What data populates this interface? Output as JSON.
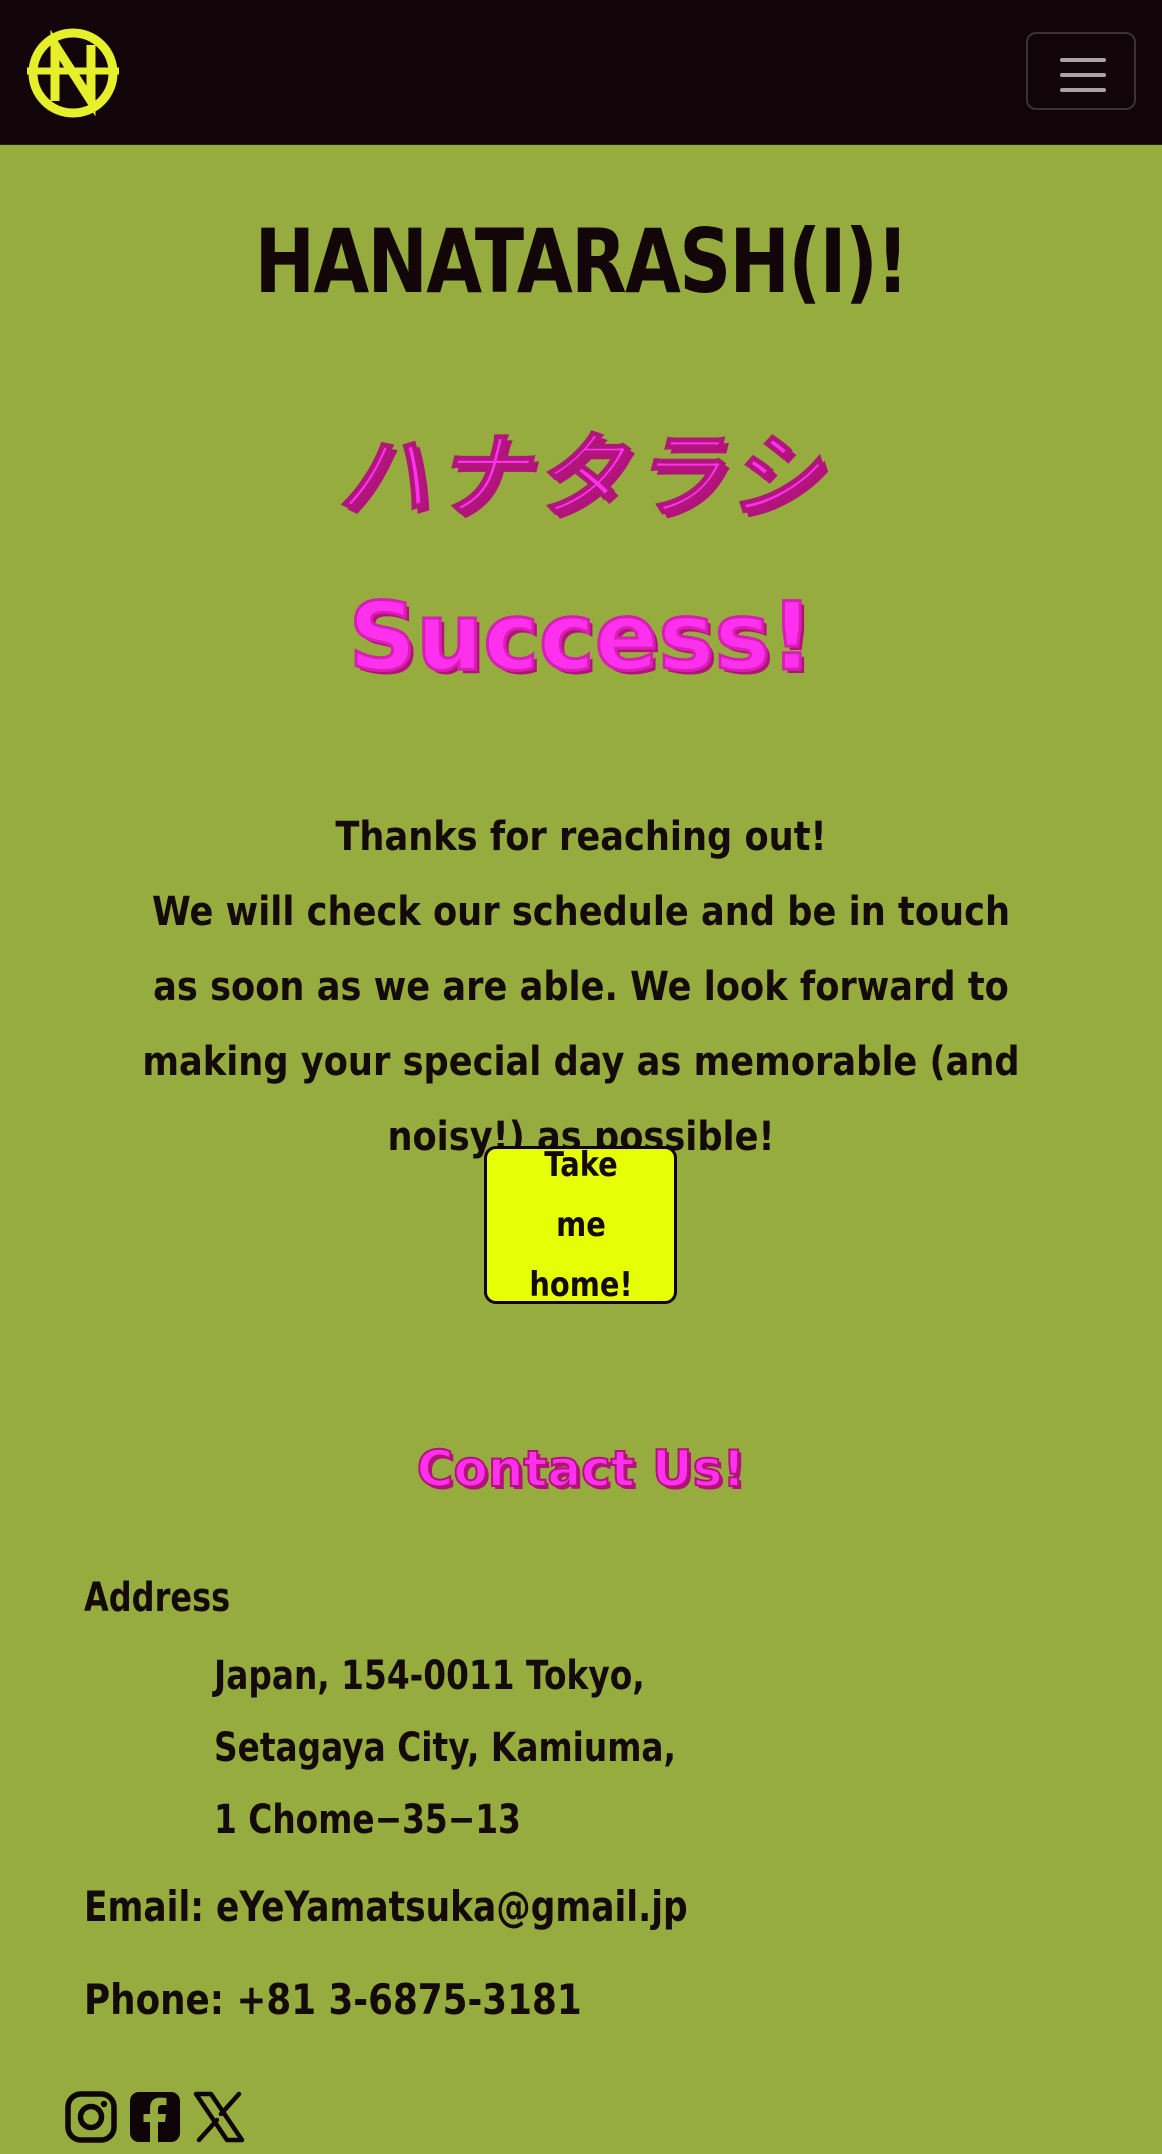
{
  "navbar": {
    "logo_icon": "hanatarashi-logo-icon",
    "menu_icon": "hamburger-menu-icon"
  },
  "hero": {
    "title": "HANATARASH(I)!",
    "japanese": "ハナタラシ",
    "status": "Success!"
  },
  "message": {
    "line1": "Thanks for reaching out!",
    "line2": "We will check our schedule and be in touch as soon as we are able. We look forward to making your special day as memorable (and noisy!) as possible!"
  },
  "home_button": {
    "label": "Take me home!"
  },
  "contact": {
    "heading": "Contact Us!",
    "address_label": "Address",
    "address_lines": [
      "Japan, 154-0011 Tokyo,",
      "Setagaya City, Kamiuma,",
      "1 Chome−35−13"
    ],
    "email": "Email: eYeYamatsuka@gmail.jp",
    "phone": "Phone: +81 3-6875-3181"
  },
  "socials": [
    {
      "name": "instagram-icon"
    },
    {
      "name": "facebook-icon"
    },
    {
      "name": "x-twitter-icon"
    }
  ],
  "colors": {
    "background": "#96ac3e",
    "navbar": "#110509",
    "accent_pink": "#ff31ef",
    "button_yellow": "#e6ff05",
    "logo_yellow": "#e6f02a"
  }
}
